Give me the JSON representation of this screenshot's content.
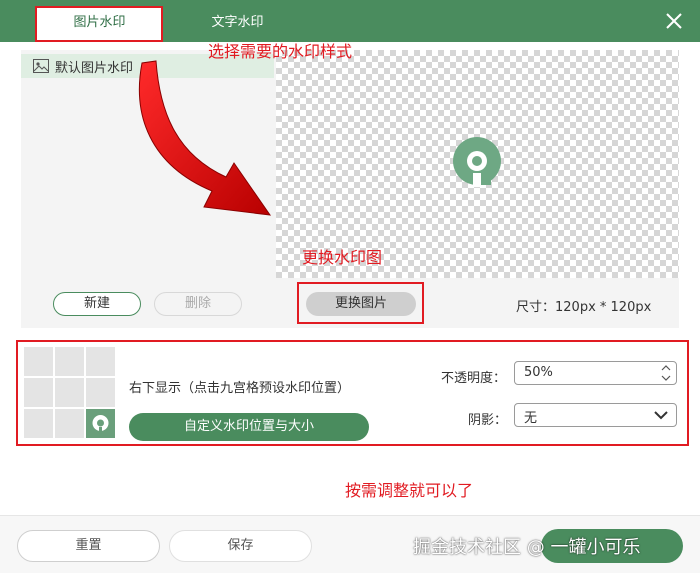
{
  "header": {
    "tabs": [
      {
        "label": "图片水印",
        "active": true
      },
      {
        "label": "文字水印",
        "active": false
      }
    ]
  },
  "annotations": {
    "select_style": "选择需要的水印样式",
    "replace_image": "更换水印图",
    "adjust": "按需调整就可以了"
  },
  "image_list": {
    "items": [
      {
        "label": "默认图片水印",
        "selected": true
      }
    ],
    "new_label": "新建",
    "delete_label": "删除"
  },
  "preview": {
    "replace_label": "更换图片",
    "size_text": "尺寸：120px * 120px"
  },
  "position": {
    "current": "右下显示（点击九宫格预设水印位置）",
    "custom_label": "自定义水印位置与大小",
    "selected_cell": 8
  },
  "settings": {
    "opacity_label": "不透明度：",
    "opacity_value": "50%",
    "shadow_label": "阴影：",
    "shadow_value": "无"
  },
  "footer": {
    "reset_label": "重置",
    "save_label": "保存",
    "watermark_text": "掘金技术社区 @ 一罐小可乐"
  },
  "colors": {
    "brand_green": "#4a8c5e",
    "annotation_red": "#e11b22"
  },
  "icons": [
    "close-icon",
    "image-icon",
    "logo-icon",
    "spinner-up-icon",
    "spinner-down-icon",
    "chevron-down-icon",
    "curved-arrow-icon"
  ]
}
